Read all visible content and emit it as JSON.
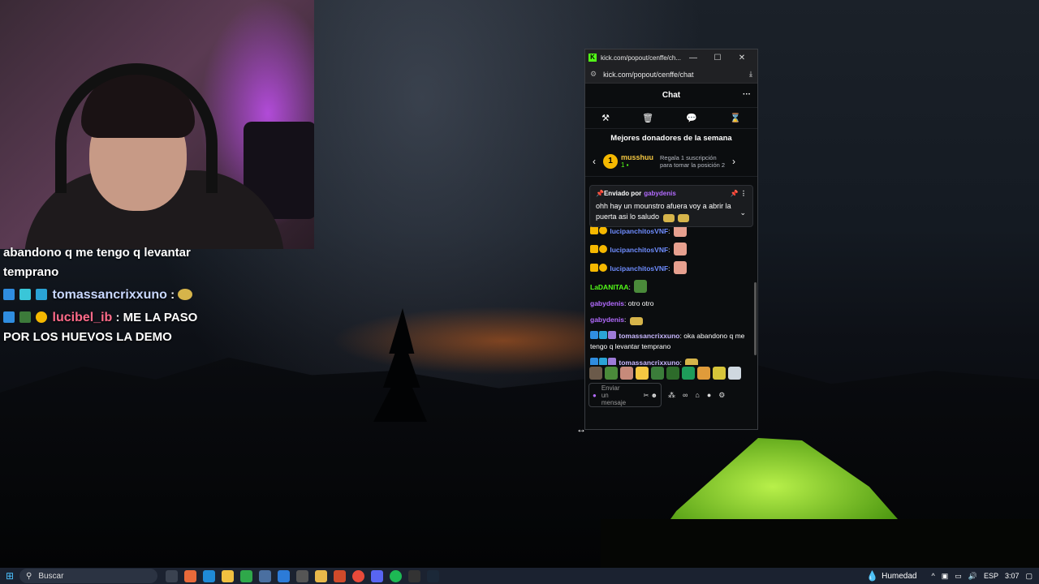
{
  "colors": {
    "kick_green": "#53fc18",
    "accent_purple": "#b36bff",
    "gold": "#f5b800"
  },
  "overlay_chat": [
    {
      "user": "",
      "text": "abandono q me tengo q levantar temprano"
    },
    {
      "user": "tomassancrixxuno",
      "sep": " :",
      "text": ""
    },
    {
      "user": "lucibel_ib",
      "sep": " :",
      "text": " ME LA PASO POR LOS HUEVOS LA DEMO"
    }
  ],
  "window": {
    "title": "kick.com/popout/cenffe/ch...",
    "controls": {
      "minimize": "—",
      "maximize": "☐",
      "close": "✕"
    },
    "url": "kick.com/popout/cenffe/chat"
  },
  "chat": {
    "header": "Chat",
    "more_icon": "···",
    "mod_tools": [
      {
        "name": "hammer-icon",
        "glyph": "⚒"
      },
      {
        "name": "trash-icon",
        "glyph": "🗑"
      },
      {
        "name": "chat-bubble-icon",
        "glyph": "💬"
      },
      {
        "name": "hourglass-icon",
        "glyph": "⌛"
      }
    ],
    "donors_title": "Mejores donadores de la semana",
    "donor": {
      "rank": "1",
      "name": "musshuu",
      "count": "1"
    },
    "gift_text": "Regala 1 suscripción para tomar la posición 2",
    "pinned": {
      "label": "Enviado por",
      "by": "gabydenis",
      "message": "ohh hay un mounstro afuera voy a abrir la puerta asi lo saludo"
    },
    "messages": [
      {
        "user": "lucipanchitosVNF",
        "user_color": "#6f8dff",
        "sep": ":",
        "text": ""
      },
      {
        "user": "lucipanchitosVNF",
        "user_color": "#6f8dff",
        "sep": ":",
        "text": ""
      },
      {
        "user": "lucipanchitosVNF",
        "user_color": "#6f8dff",
        "sep": ":",
        "text": ""
      },
      {
        "user": "LaDANITAA",
        "user_color": "#53fc18",
        "sep": ":",
        "text": ""
      },
      {
        "user": "gabydenis",
        "user_color": "#b36bff",
        "sep": ":",
        "text": " otro otro"
      },
      {
        "user": "gabydenis",
        "user_color": "#b36bff",
        "sep": ":",
        "text": ""
      },
      {
        "user": "tomassancrixxuno",
        "user_color": "#c9b8ff",
        "sep": ":",
        "text": " oka abandono q me tengo q levantar temprano"
      },
      {
        "user": "tomassancrixxuno",
        "user_color": "#c9b8ff",
        "sep": ":",
        "text": ""
      }
    ],
    "input_placeholder": "Enviar un mensaje"
  },
  "taskbar": {
    "search_placeholder": "Buscar",
    "weather": "Humedad",
    "lang": "ESP",
    "time": "3:07"
  }
}
